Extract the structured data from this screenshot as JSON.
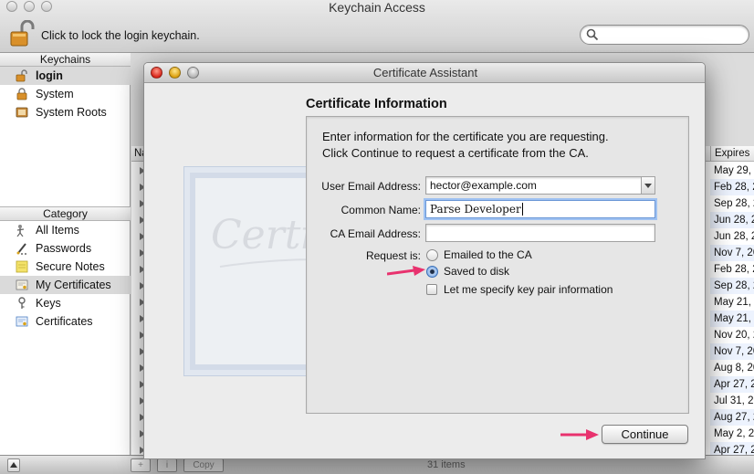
{
  "window": {
    "title": "Keychain Access",
    "lock_label": "Click to lock the login keychain."
  },
  "sidebar": {
    "keychains_header": "Keychains",
    "keychains": [
      {
        "label": "login",
        "icon": "unlocked-padlock-icon",
        "selected": true
      },
      {
        "label": "System",
        "icon": "padlock-icon"
      },
      {
        "label": "System Roots",
        "icon": "folder-icon"
      }
    ],
    "category_header": "Category",
    "categories": [
      {
        "label": "All Items",
        "icon": "people-icon"
      },
      {
        "label": "Passwords",
        "icon": "pen-icon"
      },
      {
        "label": "Secure Notes",
        "icon": "note-icon"
      },
      {
        "label": "My Certificates",
        "icon": "certificate-icon",
        "selected": true
      },
      {
        "label": "Keys",
        "icon": "key-icon"
      },
      {
        "label": "Certificates",
        "icon": "certificate-icon"
      }
    ]
  },
  "table": {
    "name_header": "Na",
    "expires_header": "Expires",
    "expires": [
      "May 29, 2",
      "Feb 28, 2",
      "Sep 28, 2",
      "Jun 28, 2",
      "Jun 28, 2",
      "Nov 7, 20",
      "Feb 28, 2",
      "Sep 28, 2",
      "May 21, 2",
      "May 21, 2",
      "Nov 20, 2",
      "Nov 7, 20",
      "Aug 8, 20",
      "Apr 27, 2",
      "Jul 31, 20",
      "Aug 27, 2",
      "May 2, 20",
      "Apr 27, 2"
    ]
  },
  "bottom_bar": {
    "add_label": "+",
    "info_label": "i",
    "copy_label": "Copy",
    "items_count": "31 items"
  },
  "dialog": {
    "title": "Certificate Assistant",
    "section_title": "Certificate Information",
    "intro_line1": "Enter information for the certificate you are requesting.",
    "intro_line2": "Click Continue to request a certificate from the CA.",
    "user_email_label": "User Email Address:",
    "user_email_value": "hector@example.com",
    "common_name_label": "Common Name:",
    "common_name_value": "Parse Developer",
    "ca_email_label": "CA Email Address:",
    "ca_email_value": "",
    "request_is_label": "Request is:",
    "option_emailed": "Emailed to the CA",
    "option_saved": "Saved to disk",
    "option_keypair": "Let me specify key pair information",
    "selected_option": "Saved to disk",
    "continue_label": "Continue",
    "watermark_text": "Certificate"
  },
  "colors": {
    "annotation_arrow": "#e8326e",
    "focus_ring": "#9fc2f2"
  }
}
